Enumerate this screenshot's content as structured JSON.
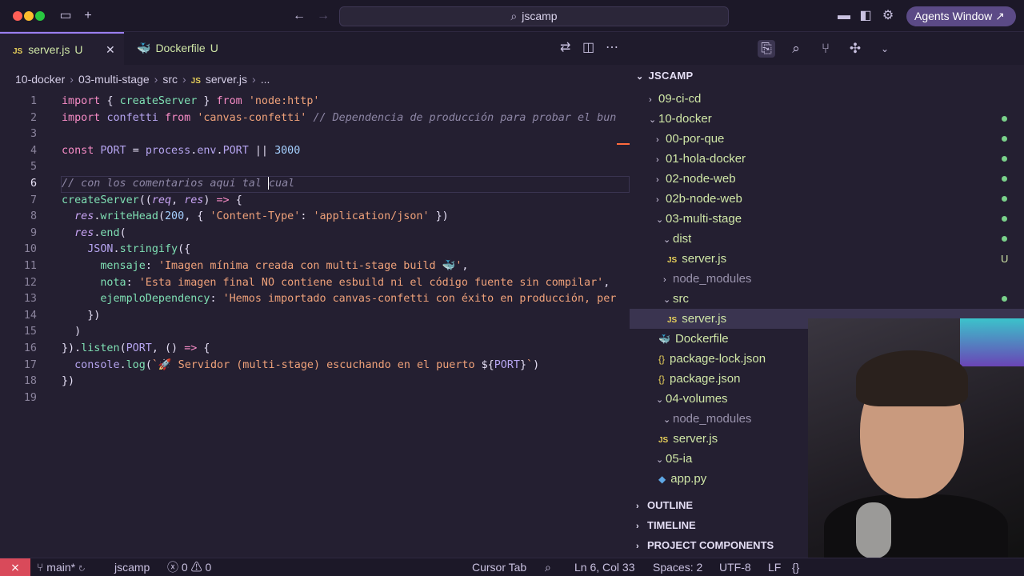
{
  "titlebar": {
    "search_text": "jscamp",
    "agents_button": "Agents Window ↗"
  },
  "tabs": [
    {
      "label": "server.js",
      "status": "U",
      "type": "js",
      "active": true
    },
    {
      "label": "Dockerfile",
      "status": "U",
      "type": "docker",
      "active": false
    }
  ],
  "breadcrumb": [
    "10-docker",
    "03-multi-stage",
    "src",
    "server.js",
    "..."
  ],
  "editor": {
    "active_line": 6,
    "line_numbers": [
      "1",
      "2",
      "3",
      "4",
      "5",
      "6",
      "7",
      "8",
      "9",
      "10",
      "11",
      "12",
      "13",
      "14",
      "15",
      "16",
      "17",
      "18",
      "19"
    ]
  },
  "explorer": {
    "title": "JSCAMP",
    "items": [
      {
        "label": "09-ci-cd",
        "kind": "folder-closed",
        "depth": 1
      },
      {
        "label": "10-docker",
        "kind": "folder-open",
        "depth": 1
      },
      {
        "label": "00-por-que",
        "kind": "folder-closed",
        "depth": 2
      },
      {
        "label": "01-hola-docker",
        "kind": "folder-closed",
        "depth": 2
      },
      {
        "label": "02-node-web",
        "kind": "folder-closed",
        "depth": 2
      },
      {
        "label": "02b-node-web",
        "kind": "folder-closed",
        "depth": 2
      },
      {
        "label": "03-multi-stage",
        "kind": "folder-open",
        "depth": 2
      },
      {
        "label": "dist",
        "kind": "folder-open",
        "depth": 3
      },
      {
        "label": "server.js",
        "kind": "js",
        "depth": 4,
        "status": "U"
      },
      {
        "label": "node_modules",
        "kind": "folder-closed",
        "depth": 3
      },
      {
        "label": "src",
        "kind": "folder-open",
        "depth": 3
      },
      {
        "label": "server.js",
        "kind": "js",
        "depth": 4
      },
      {
        "label": "Dockerfile",
        "kind": "docker",
        "depth": 3
      },
      {
        "label": "package-lock.json",
        "kind": "json",
        "depth": 3
      },
      {
        "label": "package.json",
        "kind": "json",
        "depth": 3
      },
      {
        "label": "04-volumes",
        "kind": "folder-open",
        "depth": 2
      },
      {
        "label": "node_modules",
        "kind": "folder-open",
        "depth": 3
      },
      {
        "label": "server.js",
        "kind": "js",
        "depth": 3
      },
      {
        "label": "05-ia",
        "kind": "folder-open",
        "depth": 2
      },
      {
        "label": "app.py",
        "kind": "py",
        "depth": 3
      }
    ],
    "sections": [
      "OUTLINE",
      "TIMELINE",
      "PROJECT COMPONENTS"
    ]
  },
  "statusbar": {
    "branch": "main*",
    "workspace": "jscamp",
    "errors": "0",
    "warnings": "0",
    "cursor_tab": "Cursor Tab",
    "position": "Ln 6, Col 33",
    "spaces": "Spaces: 2",
    "encoding": "UTF-8",
    "eol": "LF"
  },
  "colors": {
    "accent": "#9b7ff0",
    "agents_button": "#5b4a86",
    "remote": "#d94a5a",
    "untracked": "#cfe6a6"
  }
}
